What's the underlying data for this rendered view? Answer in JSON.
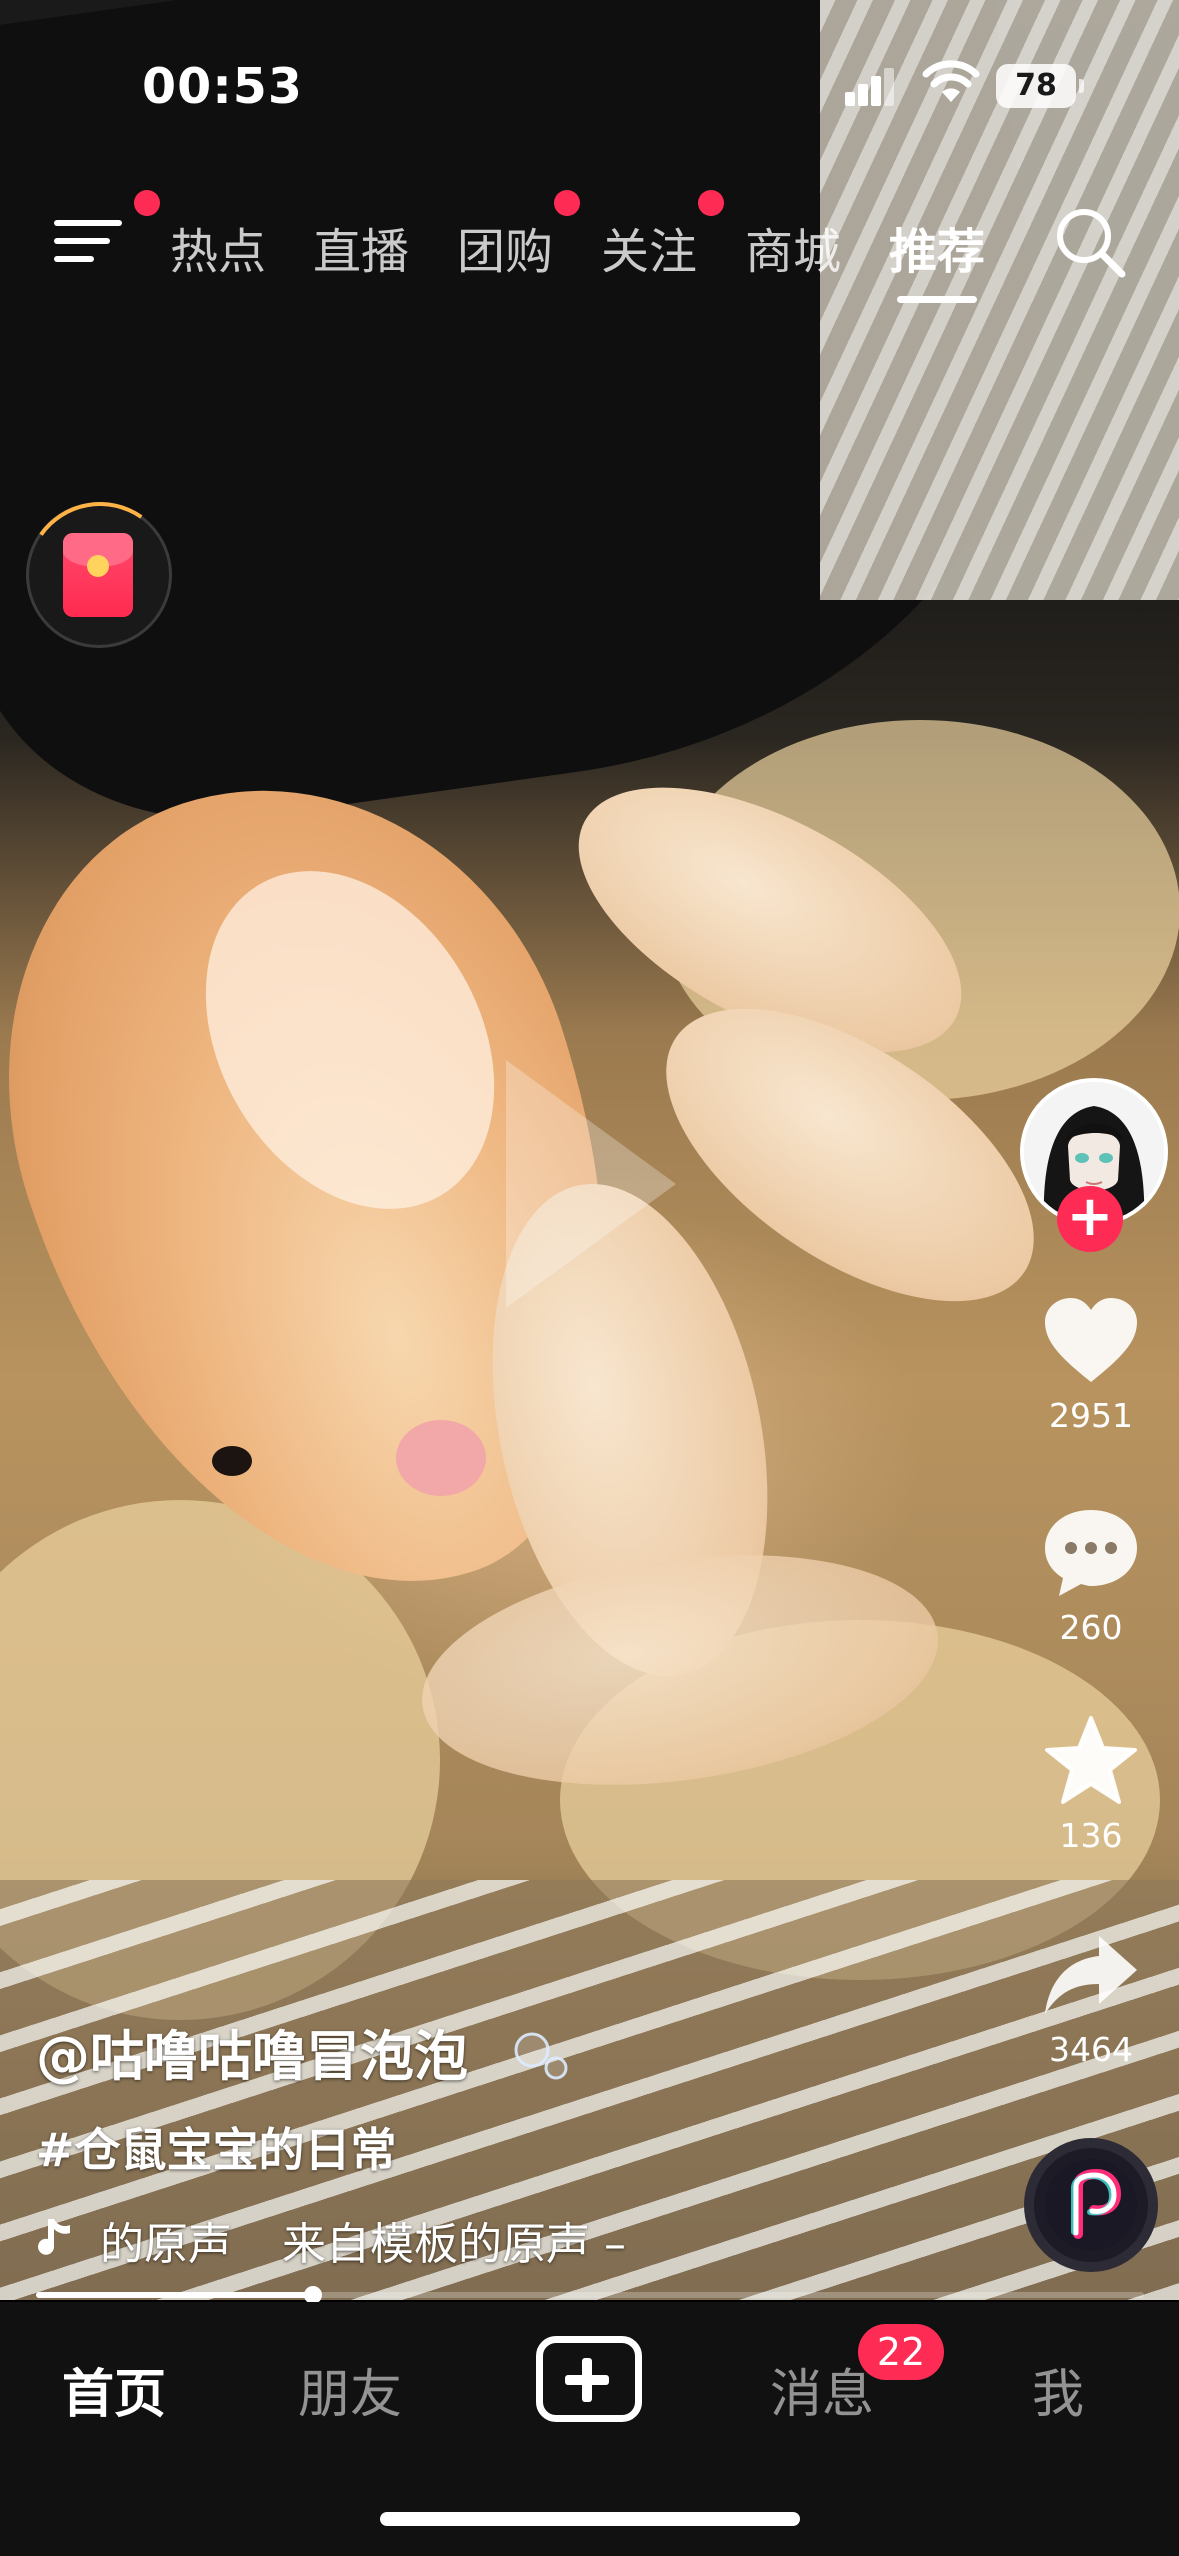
{
  "status_bar": {
    "time": "00:53",
    "battery": "78",
    "icons": [
      "cellular-signal-icon",
      "wifi-icon",
      "battery-icon"
    ]
  },
  "top_nav": {
    "menu_icon": "menu-icon",
    "tabs": [
      {
        "label": "热点",
        "active": false
      },
      {
        "label": "直播",
        "active": false
      },
      {
        "label": "团购",
        "active": false
      },
      {
        "label": "关注",
        "active": false
      },
      {
        "label": "商城",
        "active": false
      },
      {
        "label": "推荐",
        "active": true
      }
    ],
    "search_icon": "search-icon"
  },
  "side_widgets": {
    "red_packet_icon": "red-packet-icon"
  },
  "video": {
    "play_icon": "play-icon"
  },
  "actions": {
    "likes": "2951",
    "comments": "260",
    "favorites": "136",
    "shares": "3464",
    "follow_icon": "plus-icon"
  },
  "caption": {
    "author": "@咕噜咕噜冒泡泡",
    "hashtag": "#仓鼠宝宝的日常",
    "music": "的原声",
    "music_extra": "来自模板的原声 –",
    "music_icon": "music-note-icon"
  },
  "progress": {
    "fraction": 0.25
  },
  "bottom_tabs": {
    "home": "首页",
    "friends": "朋友",
    "messages": "消息",
    "messages_badge": "22",
    "me": "我"
  },
  "colors": {
    "accent": "#fe2c55",
    "tabbar_bg": "#111111"
  }
}
